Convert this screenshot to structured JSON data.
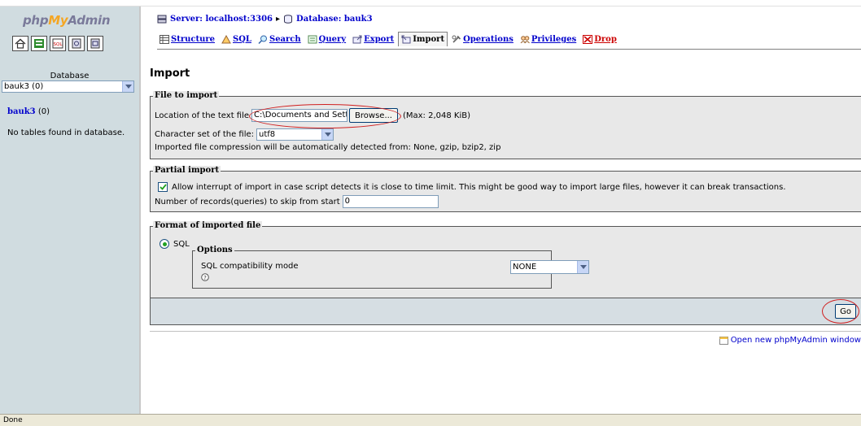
{
  "nav": {
    "logo_php": "php",
    "logo_my": "My",
    "logo_admin": "Admin",
    "database_caption": "Database",
    "database_select": "bauk3 (0)",
    "db_link_name": "bauk3",
    "db_link_count": " (0)",
    "no_tables": "No tables found in database.",
    "quick_icons": [
      "home-icon",
      "query-window-icon",
      "sql-icon",
      "docs-icon",
      "help-icon"
    ]
  },
  "breadcrumb": {
    "server": "Server: localhost:3306",
    "separator": "▸",
    "database": "Database: bauk3"
  },
  "tabs": [
    {
      "label": "Structure",
      "icon": "structure-icon"
    },
    {
      "label": "SQL",
      "icon": "sql-icon"
    },
    {
      "label": "Search",
      "icon": "search-icon"
    },
    {
      "label": "Query",
      "icon": "query-icon"
    },
    {
      "label": "Export",
      "icon": "export-icon"
    },
    {
      "label": "Import",
      "icon": "import-icon",
      "active": true
    },
    {
      "label": "Operations",
      "icon": "operations-icon"
    },
    {
      "label": "Privileges",
      "icon": "privileges-icon"
    },
    {
      "label": "Drop",
      "icon": "drop-icon"
    }
  ],
  "page_title": "Import",
  "file_to_import": {
    "legend": "File to import",
    "location_label": "Location of the text file",
    "file_value": "C:\\Documents and Setti",
    "browse_label": "Browse...",
    "max_note": "(Max: 2,048 KiB)",
    "charset_label": "Character set of the file:",
    "charset_value": "utf8",
    "compression_note": "Imported file compression will be automatically detected from: None, gzip, bzip2, zip"
  },
  "partial_import": {
    "legend": "Partial import",
    "allow_interrupt_checked": true,
    "allow_interrupt_label": "Allow interrupt of import in case script detects it is close to time limit. This might be good way to import large files, however it can break transactions.",
    "skip_label": "Number of records(queries) to skip from start",
    "skip_value": "0"
  },
  "format": {
    "legend": "Format of imported file",
    "sql_label": "SQL",
    "sql_selected": true,
    "options_legend": "Options",
    "compat_label": "SQL compatibility mode",
    "compat_value": "NONE"
  },
  "go_label": "Go",
  "open_window_label": "Open new phpMyAdmin window",
  "status_text": "Done",
  "colors": {
    "nav_bg": "#d0dce0",
    "link": "#0000cc",
    "drop": "#cc0000",
    "panel_bg": "#e8e8e8",
    "annotation": "#d02020"
  }
}
